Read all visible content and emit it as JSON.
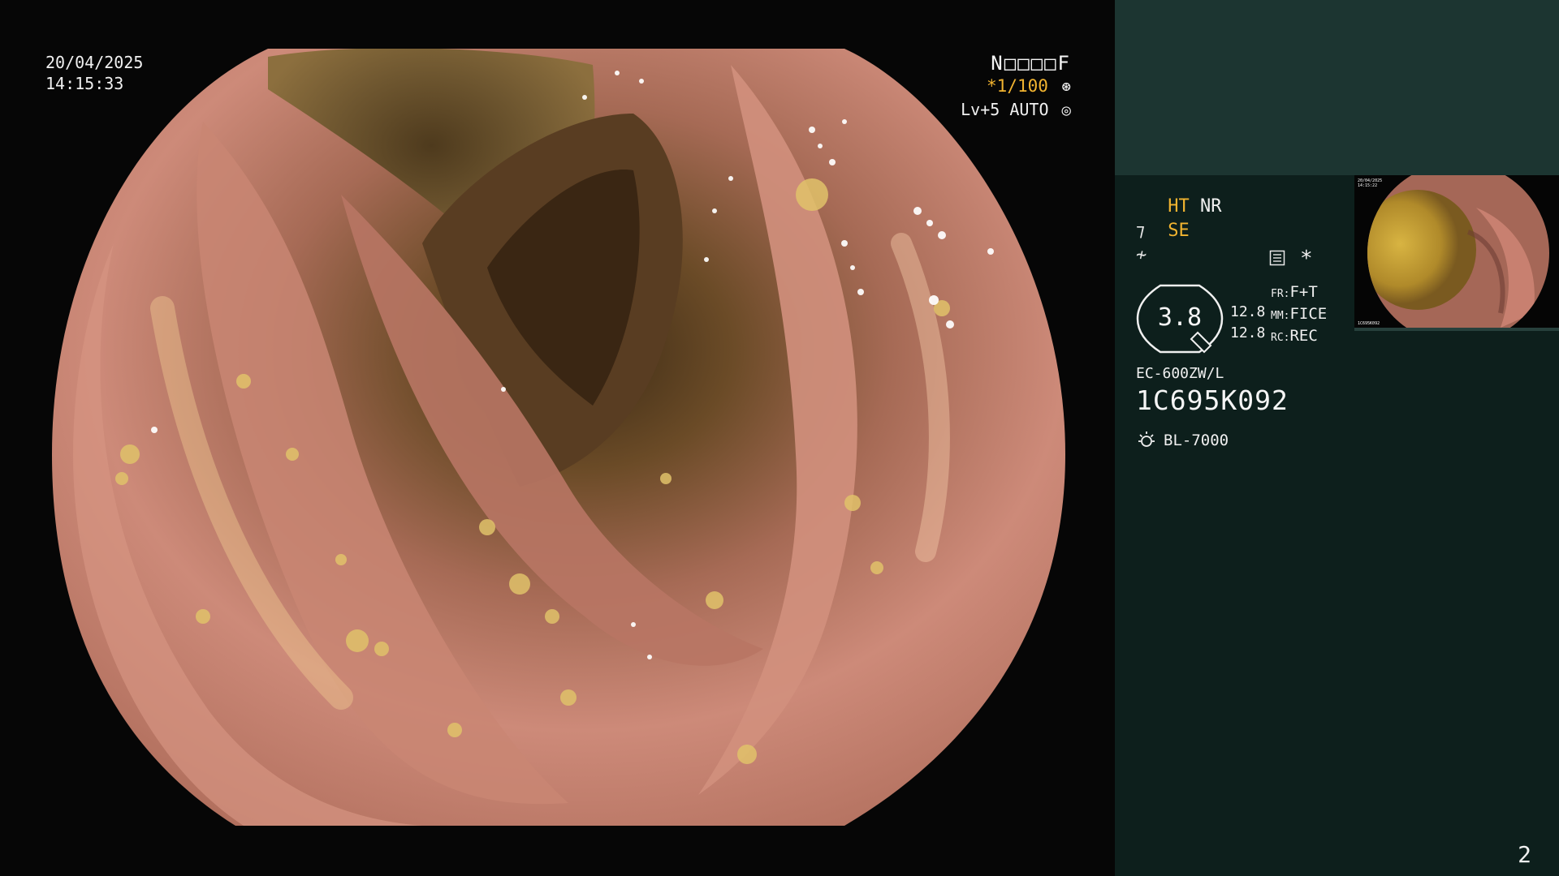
{
  "overlay": {
    "date": "20/04/2025",
    "time": "14:15:33",
    "patient_id": "N□□□□F",
    "shutter": "*1/100",
    "shutter_icon": "aperture-icon",
    "level": "Lv+5",
    "iris": "AUTO",
    "iris_icon": "iris-icon"
  },
  "panel": {
    "ht_label": "HT",
    "nr_label": "NR",
    "se_label": "SE",
    "gauge_value": "3.8",
    "gauge_left_top": "12.8",
    "gauge_left_bottom": "12.8",
    "fr_key": "FR:",
    "fr_value": "F+T",
    "mm_key": "MM:",
    "mm_value": "FICE",
    "rc_key": "RC:",
    "rc_value": "REC",
    "asterisk": "*",
    "scope_model": "EC-600ZW/L",
    "scope_serial": "1C695K092",
    "light_source": "BL-7000",
    "top_band_color": "#1c3531",
    "panel_color": "#0d1f1c",
    "accent_color": "#f2b430"
  },
  "thumbnail": {
    "date": "20/04/2025",
    "time": "14:15:22",
    "serial": "1C695K092"
  },
  "page_number": "2"
}
